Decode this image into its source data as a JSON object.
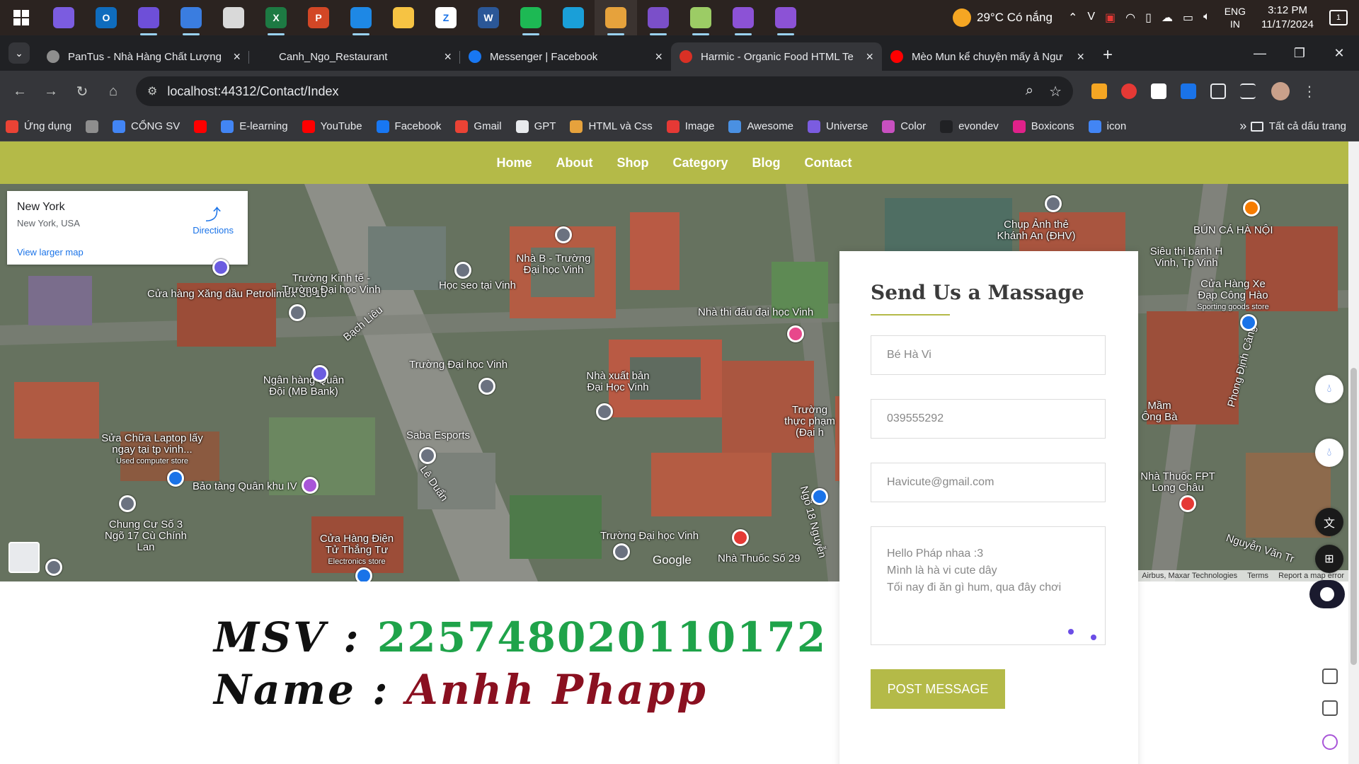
{
  "taskbar": {
    "apps": [
      {
        "icon": "copilot-icon",
        "color": "#7b5ce0",
        "letter": ""
      },
      {
        "icon": "outlook-icon",
        "color": "#0f6cbd",
        "letter": "O"
      },
      {
        "icon": "git-icon",
        "color": "#6e4fd8",
        "letter": ""
      },
      {
        "icon": "store-icon",
        "color": "#3a7de0",
        "letter": ""
      },
      {
        "icon": "figma-icon",
        "color": "#d9d9d9",
        "letter": ""
      },
      {
        "icon": "excel-icon",
        "color": "#1d7a43",
        "letter": "X"
      },
      {
        "icon": "powerpoint-icon",
        "color": "#d24726",
        "letter": "P"
      },
      {
        "icon": "vscode-icon",
        "color": "#1e88e5",
        "letter": ""
      },
      {
        "icon": "file-explorer-icon",
        "color": "#f6c343",
        "letter": ""
      },
      {
        "icon": "zalo-icon",
        "color": "#ffffff",
        "letter": "Z"
      },
      {
        "icon": "word-icon",
        "color": "#2b5797",
        "letter": "W"
      },
      {
        "icon": "spotify-icon",
        "color": "#1db954",
        "letter": ""
      },
      {
        "icon": "edge-icon",
        "color": "#1a9fd8",
        "letter": ""
      },
      {
        "icon": "chrome-icon",
        "color": "#e6a23c",
        "letter": ""
      },
      {
        "icon": "visual-studio-icon",
        "color": "#7b4fc9",
        "letter": ""
      },
      {
        "icon": "paint-icon",
        "color": "#9ccc65",
        "letter": ""
      },
      {
        "icon": "visual-studio-preview-icon",
        "color": "#8c52d6",
        "letter": ""
      },
      {
        "icon": "visual-studio-preview-2-icon",
        "color": "#8c52d6",
        "letter": ""
      }
    ],
    "weather": "29°C  Có nắng",
    "lang_top": "ENG",
    "lang_bottom": "IN",
    "time": "3:12 PM",
    "date": "11/17/2024",
    "notifications": "1"
  },
  "tabs": [
    {
      "title": "PanTus - Nhà Hàng Chất Lượng",
      "color": "#8e8e8e",
      "active": false
    },
    {
      "title": "Canh_Ngo_Restaurant",
      "color": "#202124",
      "active": false
    },
    {
      "title": "Messenger | Facebook",
      "color": "#1877f2",
      "active": false
    },
    {
      "title": "Harmic - Organic Food HTML Te",
      "color": "#d93025",
      "active": true
    },
    {
      "title": "Mèo Mun kể chuyện mấy ả Ngư",
      "color": "#ff0000",
      "active": false
    }
  ],
  "address": {
    "url": "localhost:44312/Contact/Index"
  },
  "bookmarks": [
    {
      "label": "Ứng dụng",
      "color": "#ea4335"
    },
    {
      "label": "",
      "color": "#8e8e8e"
    },
    {
      "label": "CỔNG SV",
      "color": "#4285f4"
    },
    {
      "label": "",
      "color": "#ff0000"
    },
    {
      "label": "E-learning",
      "color": "#4285f4"
    },
    {
      "label": "YouTube",
      "color": "#ff0000"
    },
    {
      "label": "Facebook",
      "color": "#1877f2"
    },
    {
      "label": "Gmail",
      "color": "#ea4335"
    },
    {
      "label": "GPT",
      "color": "#e8eaed"
    },
    {
      "label": "HTML và Css",
      "color": "#e6a23c"
    },
    {
      "label": "Image",
      "color": "#e53935"
    },
    {
      "label": "Awesome",
      "color": "#4a90e2"
    },
    {
      "label": "Universe",
      "color": "#7b5ce0"
    },
    {
      "label": "Color",
      "color": "#c850c0"
    },
    {
      "label": "evondev",
      "color": "#202124"
    },
    {
      "label": "Boxicons",
      "color": "#e0218a"
    },
    {
      "label": "icon",
      "color": "#4285f4"
    }
  ],
  "bookmarks_all": "Tất cả dấu trang",
  "site_nav": [
    "Home",
    "About",
    "Shop",
    "Category",
    "Blog",
    "Contact"
  ],
  "map": {
    "place_name": "New York",
    "place_address": "New York, USA",
    "directions": "Directions",
    "larger_map": "View larger map",
    "google": "Google",
    "footer": [
      "Airbus, Maxar Technologies",
      "Terms",
      "Report a map error"
    ],
    "labels": [
      {
        "text": "Cửa hàng Xăng dầu Petrolimex Số 10",
        "sub": ""
      },
      {
        "text": "Trường Kinh tế - Trường Đại học Vinh",
        "sub": ""
      },
      {
        "text": "Học seo tại Vinh",
        "sub": ""
      },
      {
        "text": "Nhà B - Trường Đại học Vinh",
        "sub": ""
      },
      {
        "text": "Nhà thi đấu đại học Vinh",
        "sub": ""
      },
      {
        "text": "Chụp Ảnh thẻ Khánh An (ĐHV)",
        "sub": ""
      },
      {
        "text": "BÚN CÁ HÀ NỘI",
        "sub": ""
      },
      {
        "text": "Siêu thị bánh H Vinh, Tp Vinh",
        "sub": ""
      },
      {
        "text": "Cửa Hàng Xe Đạp Công Hào",
        "sub": "Sporting goods store"
      },
      {
        "text": "Bạch Liêu",
        "sub": ""
      },
      {
        "text": "Trường Đại học Vinh",
        "sub": ""
      },
      {
        "text": "Nhà xuất bản Đại Học Vinh",
        "sub": ""
      },
      {
        "text": "Ngân hàng Quân Đội (MB Bank)",
        "sub": ""
      },
      {
        "text": "Sửa Chữa Laptop lấy ngay tại tp vinh...",
        "sub": "Used computer store"
      },
      {
        "text": "Saba Esports",
        "sub": ""
      },
      {
        "text": "Bảo tàng Quân khu IV",
        "sub": ""
      },
      {
        "text": "Chung Cư Số 3 Ngõ 17 Cù Chính Lan",
        "sub": ""
      },
      {
        "text": "Lê Duẩn",
        "sub": ""
      },
      {
        "text": "Cửa Hàng Điện Tử Thắng Tư",
        "sub": "Electronics store"
      },
      {
        "text": "Trường Đại học Vinh",
        "sub": ""
      },
      {
        "text": "Nhà Thuốc Số 29",
        "sub": ""
      },
      {
        "text": "Trường thực phạm (Đại h",
        "sub": ""
      },
      {
        "text": "Mầm Ông Bà",
        "sub": ""
      },
      {
        "text": "Nhà Thuốc FPT Long Châu",
        "sub": ""
      },
      {
        "text": "Phong Định Cảng",
        "sub": ""
      },
      {
        "text": "Nguyễn Văn Tr",
        "sub": ""
      },
      {
        "text": "Ngõ 18 Nguyễn",
        "sub": ""
      }
    ]
  },
  "form": {
    "title": "Send Us a Massage",
    "name_value": "Bé Hà Vi",
    "phone_value": "039555292",
    "email_value": "Havicute@gmail.com",
    "message_lines": [
      "Hello Pháp nhaa :3",
      "Mình là hà vi cute dây",
      "Tối nay đi ăn gì hum, qua đây chơi"
    ],
    "submit": "POST MESSAGE"
  },
  "student": {
    "msv_label": "MSV",
    "msv_sep": " : ",
    "msv_value": "225748020110172",
    "name_label": "Name",
    "name_sep": " : ",
    "name_value": "Anhh Phapp"
  }
}
